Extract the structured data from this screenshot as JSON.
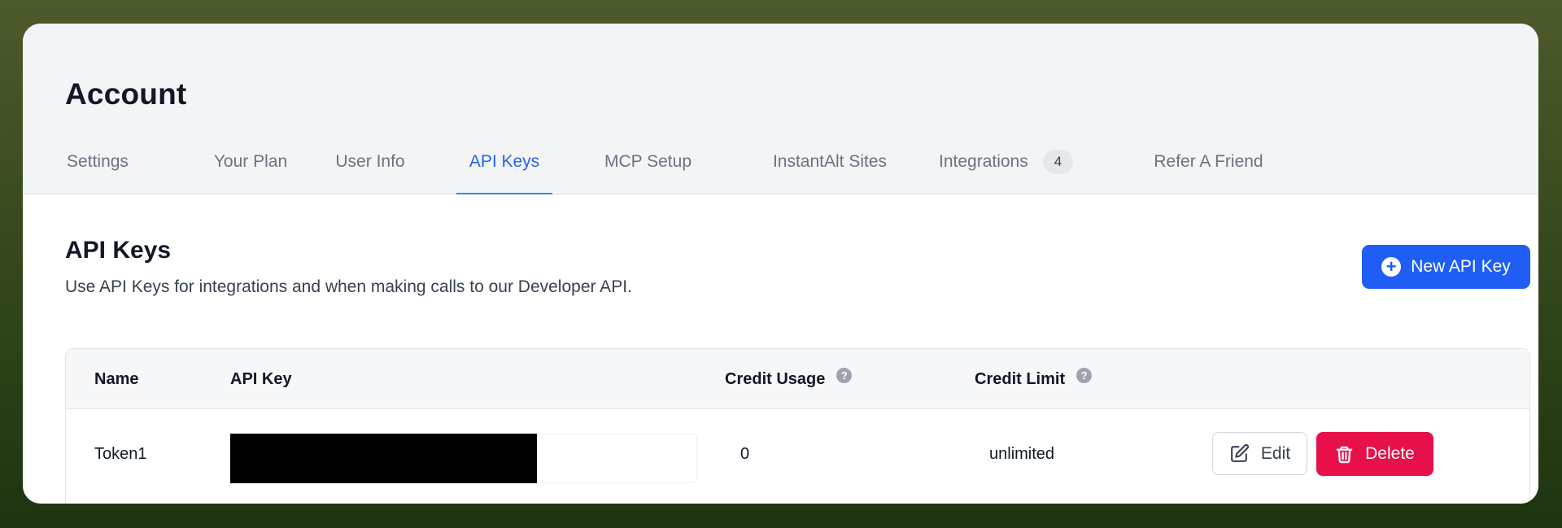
{
  "account": {
    "title": "Account",
    "tabs": [
      {
        "label": "Settings"
      },
      {
        "label": "Your Plan"
      },
      {
        "label": "User Info"
      },
      {
        "label": "API Keys",
        "active": true
      },
      {
        "label": "MCP Setup"
      },
      {
        "label": "InstantAlt Sites"
      },
      {
        "label": "Integrations",
        "badge": "4"
      },
      {
        "label": "Refer A Friend"
      }
    ]
  },
  "api_keys": {
    "title": "API Keys",
    "description": "Use API Keys for integrations and when making calls to our Developer API.",
    "new_button_label": "New API Key",
    "table": {
      "headers": {
        "name": "Name",
        "api_key": "API Key",
        "credit_usage": "Credit Usage",
        "credit_limit": "Credit Limit"
      },
      "rows": [
        {
          "name": "Token1",
          "credit_usage": "0",
          "credit_limit": "unlimited"
        }
      ]
    },
    "actions": {
      "edit_label": "Edit",
      "delete_label": "Delete"
    }
  },
  "colors": {
    "primary": "#1f5ef5",
    "active_tab": "#2563eb",
    "danger": "#e8104a",
    "background_gradient": [
      "#4d5a2c",
      "#1d3510"
    ]
  },
  "icons": {
    "new_button": "plus-circle-icon",
    "help": "question-circle-icon",
    "edit": "edit-icon",
    "delete": "trash-icon"
  }
}
